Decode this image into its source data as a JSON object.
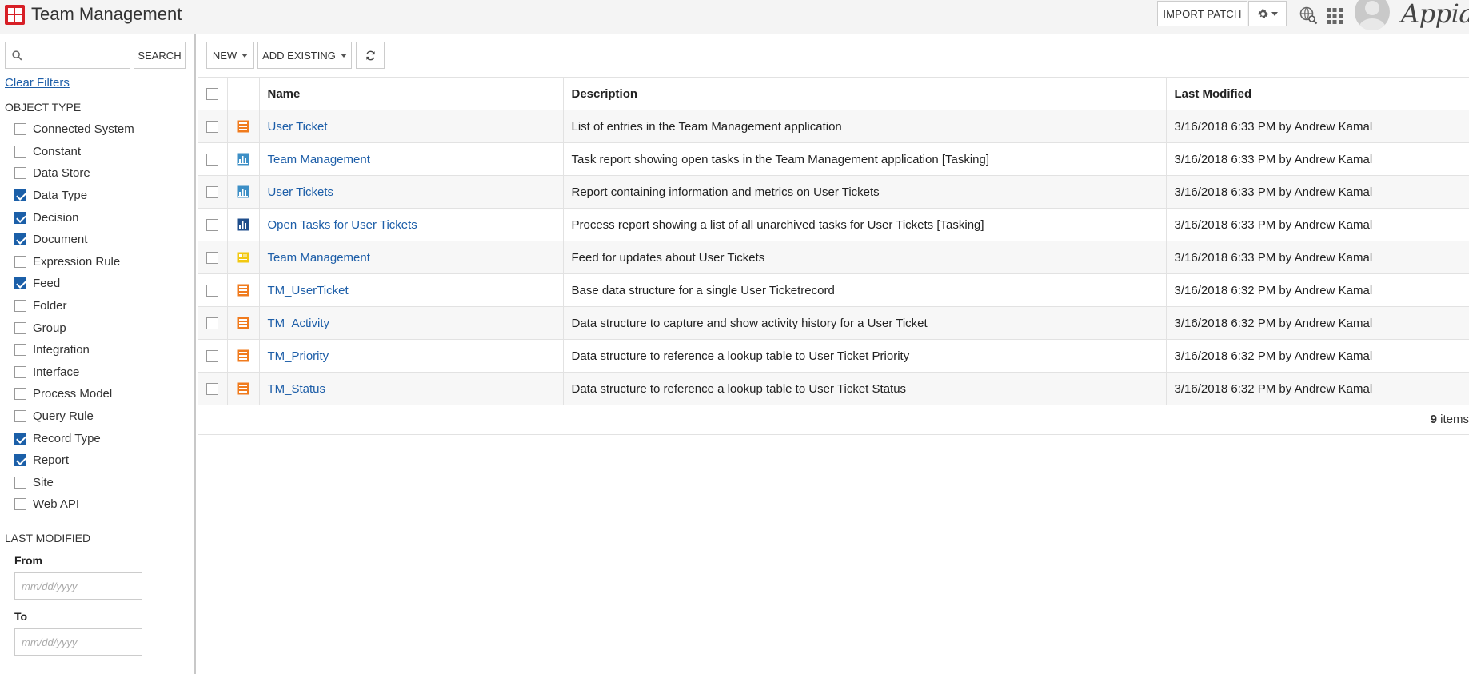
{
  "header": {
    "title": "Team Management",
    "import_label": "IMPORT PATCH",
    "brand": "Appian"
  },
  "sidebar": {
    "search_placeholder": "",
    "search_label": "SEARCH",
    "clear_filters": "Clear Filters",
    "object_type_label": "OBJECT TYPE",
    "object_types": [
      {
        "label": "Connected System",
        "checked": false
      },
      {
        "label": "Constant",
        "checked": false
      },
      {
        "label": "Data Store",
        "checked": false
      },
      {
        "label": "Data Type",
        "checked": true
      },
      {
        "label": "Decision",
        "checked": true
      },
      {
        "label": "Document",
        "checked": true
      },
      {
        "label": "Expression Rule",
        "checked": false
      },
      {
        "label": "Feed",
        "checked": true
      },
      {
        "label": "Folder",
        "checked": false
      },
      {
        "label": "Group",
        "checked": false
      },
      {
        "label": "Integration",
        "checked": false
      },
      {
        "label": "Interface",
        "checked": false
      },
      {
        "label": "Process Model",
        "checked": false
      },
      {
        "label": "Query Rule",
        "checked": false
      },
      {
        "label": "Record Type",
        "checked": true
      },
      {
        "label": "Report",
        "checked": true
      },
      {
        "label": "Site",
        "checked": false
      },
      {
        "label": "Web API",
        "checked": false
      }
    ],
    "last_modified_label": "LAST MODIFIED",
    "from_label": "From",
    "to_label": "To",
    "date_placeholder": "mm/dd/yyyy"
  },
  "toolbar": {
    "new_label": "NEW",
    "add_existing_label": "ADD EXISTING"
  },
  "table": {
    "columns": [
      "Name",
      "Description",
      "Last Modified"
    ],
    "rows": [
      {
        "icon": "record-type-icon",
        "color": "#f07b1e",
        "name": "User Ticket",
        "description": "List of entries in the Team Management application",
        "modified": "3/16/2018 6:33 PM by Andrew Kamal"
      },
      {
        "icon": "report-icon",
        "color": "#3d8fc6",
        "name": "Team Management",
        "description": "Task report showing open tasks in the Team Management application [Tasking]",
        "modified": "3/16/2018 6:33 PM by Andrew Kamal"
      },
      {
        "icon": "report-icon",
        "color": "#3d8fc6",
        "name": "User Tickets",
        "description": "Report containing information and metrics on User Tickets",
        "modified": "3/16/2018 6:33 PM by Andrew Kamal"
      },
      {
        "icon": "process-report-icon",
        "color": "#1f4e8c",
        "name": "Open Tasks for User Tickets",
        "description": "Process report showing a list of all unarchived tasks for User Tickets [Tasking]",
        "modified": "3/16/2018 6:33 PM by Andrew Kamal"
      },
      {
        "icon": "feed-icon",
        "color": "#f2c811",
        "name": "Team Management",
        "description": "Feed for updates about User Tickets",
        "modified": "3/16/2018 6:33 PM by Andrew Kamal"
      },
      {
        "icon": "data-type-icon",
        "color": "#f07b1e",
        "name": "TM_UserTicket",
        "description": "Base data structure for a single User Ticketrecord",
        "modified": "3/16/2018 6:32 PM by Andrew Kamal"
      },
      {
        "icon": "data-type-icon",
        "color": "#f07b1e",
        "name": "TM_Activity",
        "description": "Data structure to capture and show activity history for a User Ticket",
        "modified": "3/16/2018 6:32 PM by Andrew Kamal"
      },
      {
        "icon": "data-type-icon",
        "color": "#f07b1e",
        "name": "TM_Priority",
        "description": "Data structure to reference a lookup table to User Ticket Priority",
        "modified": "3/16/2018 6:32 PM by Andrew Kamal"
      },
      {
        "icon": "data-type-icon",
        "color": "#f07b1e",
        "name": "TM_Status",
        "description": "Data structure to reference a lookup table to User Ticket Status",
        "modified": "3/16/2018 6:32 PM by Andrew Kamal"
      }
    ],
    "item_count": "9",
    "items_suffix": "items"
  },
  "colors": {
    "brand_red": "#d71f26",
    "link": "#1d5ea8",
    "checkbox": "#1b5fa8"
  }
}
